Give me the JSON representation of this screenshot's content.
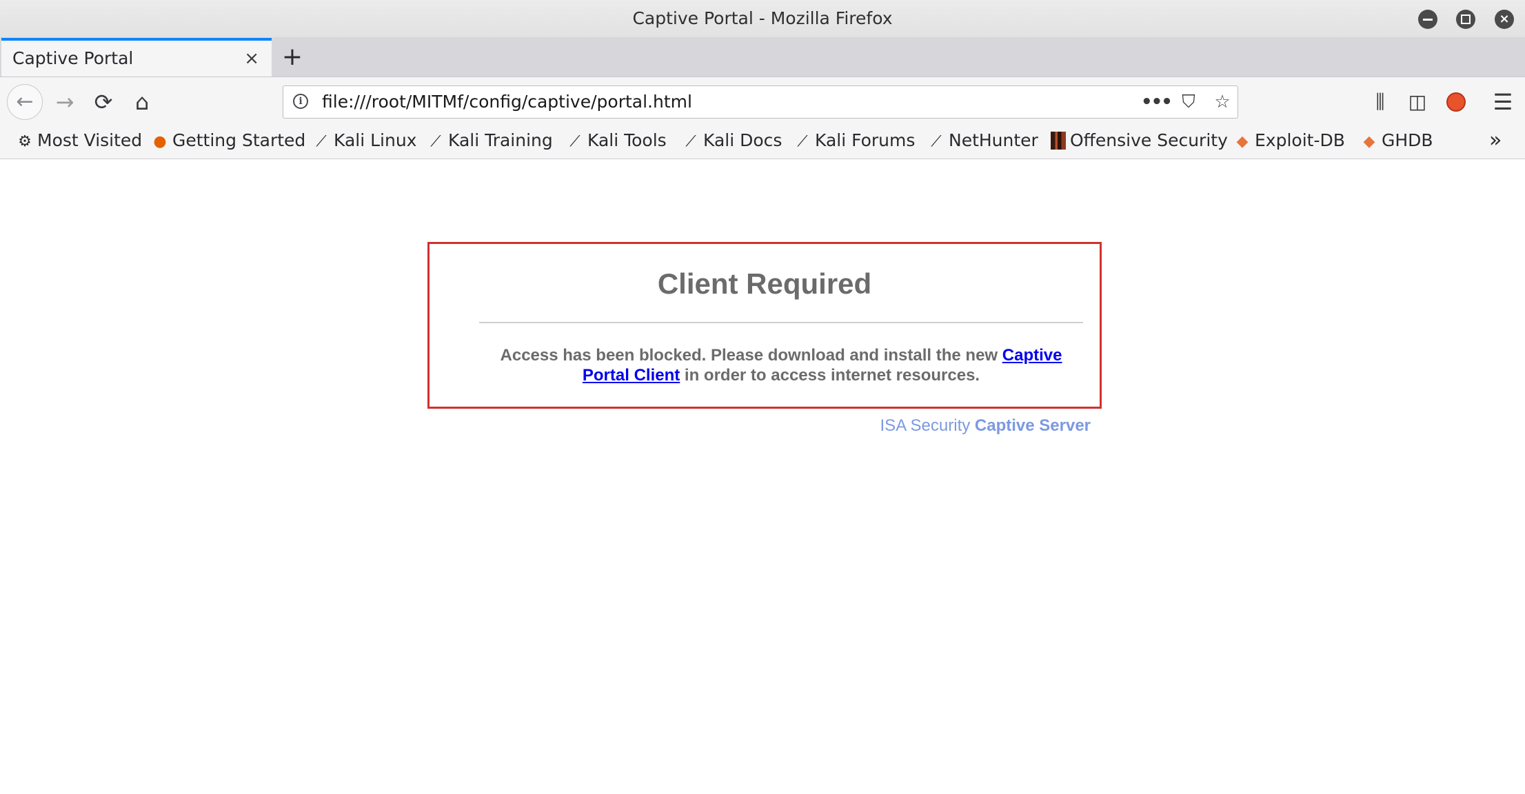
{
  "window": {
    "title": "Captive Portal - Mozilla Firefox",
    "minimize_glyph": "–",
    "maximize_glyph": "□",
    "close_glyph": "×"
  },
  "tabs": [
    {
      "label": "Captive Portal",
      "active": true,
      "close_glyph": "×"
    }
  ],
  "new_tab_glyph": "+",
  "navigation": {
    "back_glyph": "←",
    "forward_glyph": "→",
    "reload_glyph": "⟳",
    "home_glyph": "⌂"
  },
  "urlbar": {
    "info_glyph": "i",
    "url": "file:///root/MITMf/config/captive/portal.html",
    "more_glyph": "•••",
    "pocket_glyph": "⛉",
    "star_glyph": "☆"
  },
  "toolbar": {
    "library_glyph": "⫼",
    "sidebar_glyph": "◫",
    "menu_glyph": "☰"
  },
  "bookmarks": {
    "items": [
      {
        "label": "Most Visited",
        "icon": "gear-icon",
        "glyph": "⚙"
      },
      {
        "label": "Getting Started",
        "icon": "firefox-icon",
        "glyph": "●"
      },
      {
        "label": "Kali Linux",
        "icon": "kali-dragon-icon",
        "glyph": "⟋"
      },
      {
        "label": "Kali Training",
        "icon": "kali-dragon-icon",
        "glyph": "⟋"
      },
      {
        "label": "Kali Tools",
        "icon": "kali-dragon-icon",
        "glyph": "⟋"
      },
      {
        "label": "Kali Docs",
        "icon": "kali-dragon-icon",
        "glyph": "⟋"
      },
      {
        "label": "Kali Forums",
        "icon": "kali-dragon-icon",
        "glyph": "⟋"
      },
      {
        "label": "NetHunter",
        "icon": "kali-dragon-icon",
        "glyph": "⟋"
      },
      {
        "label": "Offensive Security",
        "icon": "offsec-icon",
        "glyph": ""
      },
      {
        "label": "Exploit-DB",
        "icon": "exploit-db-icon",
        "glyph": "◆"
      },
      {
        "label": "GHDB",
        "icon": "exploit-db-icon",
        "glyph": "◆"
      }
    ],
    "overflow_glyph": "»"
  },
  "page": {
    "heading": "Client Required",
    "message_before": "Access has been blocked. Please download and install the new ",
    "link_text": "Captive Portal Client",
    "message_after": " in order to access internet resources.",
    "footer_prefix": "ISA Security ",
    "footer_strong": "Captive Server"
  },
  "colors": {
    "tab_accent": "#0a84ff",
    "box_border": "#d0312d",
    "link": "#0000ee",
    "footer": "#7c99e0",
    "text_gray": "#6b6b6b"
  }
}
